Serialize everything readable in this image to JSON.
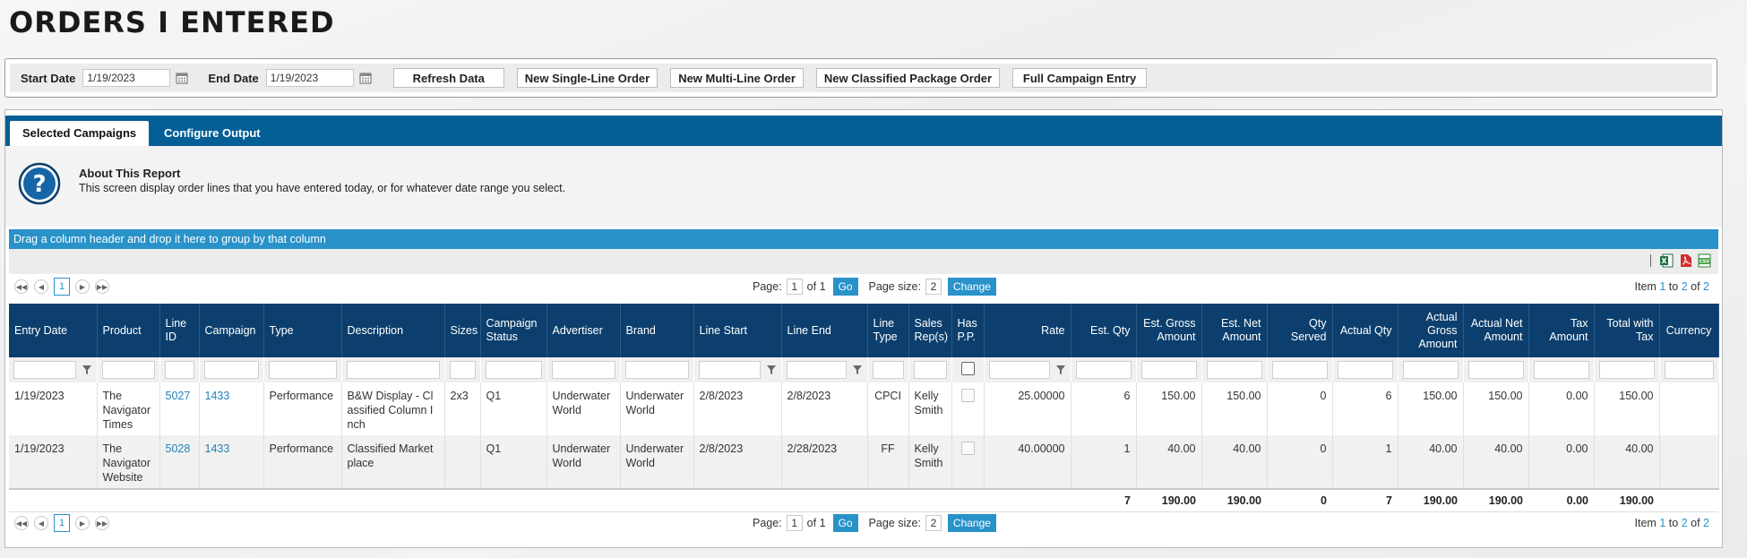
{
  "page_title": "ORDERS I ENTERED",
  "toolbar": {
    "start_label": "Start Date",
    "start_value": "1/19/2023",
    "end_label": "End Date",
    "end_value": "1/19/2023",
    "buttons": [
      "Refresh Data",
      "New Single-Line Order",
      "New Multi-Line Order",
      "New Classified Package Order",
      "Full Campaign Entry"
    ]
  },
  "tabs": [
    "Selected Campaigns",
    "Configure Output"
  ],
  "about": {
    "title": "About This Report",
    "description": "This screen display order lines that you have entered today, or for whatever date range you select."
  },
  "group_hint": "Drag a column header and drop it here to group by that column",
  "pager": {
    "current_page": "1",
    "page_label": "Page:",
    "of_label": "of 1",
    "go_label": "Go",
    "page_size_label": "Page size:",
    "page_size": "2",
    "change_label": "Change",
    "item_prefix": "Item",
    "item_from": "1",
    "item_to_label": "to",
    "item_to": "2",
    "item_of_label": "of",
    "item_total": "2"
  },
  "columns": [
    "Entry Date",
    "Product",
    "Line ID",
    "Campaign",
    "Type",
    "Description",
    "Sizes",
    "Campaign Status",
    "Advertiser",
    "Brand",
    "Line Start",
    "Line End",
    "Line Type",
    "Sales Rep(s)",
    "Has P.P.",
    "Rate",
    "Est. Qty",
    "Est. Gross Amount",
    "Est. Net Amount",
    "Qty Served",
    "Actual Qty",
    "Actual Gross Amount",
    "Actual Net Amount",
    "Tax Amount",
    "Total with Tax",
    "Currency"
  ],
  "rows": [
    {
      "entry_date": "1/19/2023",
      "product": "The Navigator Times",
      "line_id": "5027",
      "campaign": "1433",
      "type": "Performance",
      "description": "B&W Display - Classified Column Inch",
      "sizes": "2x3",
      "status": "Q1",
      "advertiser": "Underwater World",
      "brand": "Underwater World",
      "line_start": "2/8/2023",
      "line_end": "2/8/2023",
      "line_type": "CPCI",
      "sales_rep": "Kelly Smith",
      "rate": "25.00000",
      "est_qty": "6",
      "est_gross": "150.00",
      "est_net": "150.00",
      "qty_served": "0",
      "actual_qty": "6",
      "actual_gross": "150.00",
      "actual_net": "150.00",
      "tax": "0.00",
      "total": "150.00",
      "currency": ""
    },
    {
      "entry_date": "1/19/2023",
      "product": "The Navigator Website",
      "line_id": "5028",
      "campaign": "1433",
      "type": "Performance",
      "description": "Classified Marketplace",
      "sizes": "",
      "status": "Q1",
      "advertiser": "Underwater World",
      "brand": "Underwater World",
      "line_start": "2/8/2023",
      "line_end": "2/28/2023",
      "line_type": "FF",
      "sales_rep": "Kelly Smith",
      "rate": "40.00000",
      "est_qty": "1",
      "est_gross": "40.00",
      "est_net": "40.00",
      "qty_served": "0",
      "actual_qty": "1",
      "actual_gross": "40.00",
      "actual_net": "40.00",
      "tax": "0.00",
      "total": "40.00",
      "currency": ""
    }
  ],
  "totals": {
    "est_qty": "7",
    "est_gross": "190.00",
    "est_net": "190.00",
    "qty_served": "0",
    "actual_qty": "7",
    "actual_gross": "190.00",
    "actual_net": "190.00",
    "tax": "0.00",
    "total": "190.00"
  },
  "colors": {
    "header_bg": "#0c3f6d",
    "tab_bar": "#035f96",
    "accent": "#2892c9"
  },
  "icons": [
    "calendar-icon",
    "help-icon",
    "excel-icon",
    "pdf-icon",
    "csv-icon",
    "filter-icon"
  ]
}
